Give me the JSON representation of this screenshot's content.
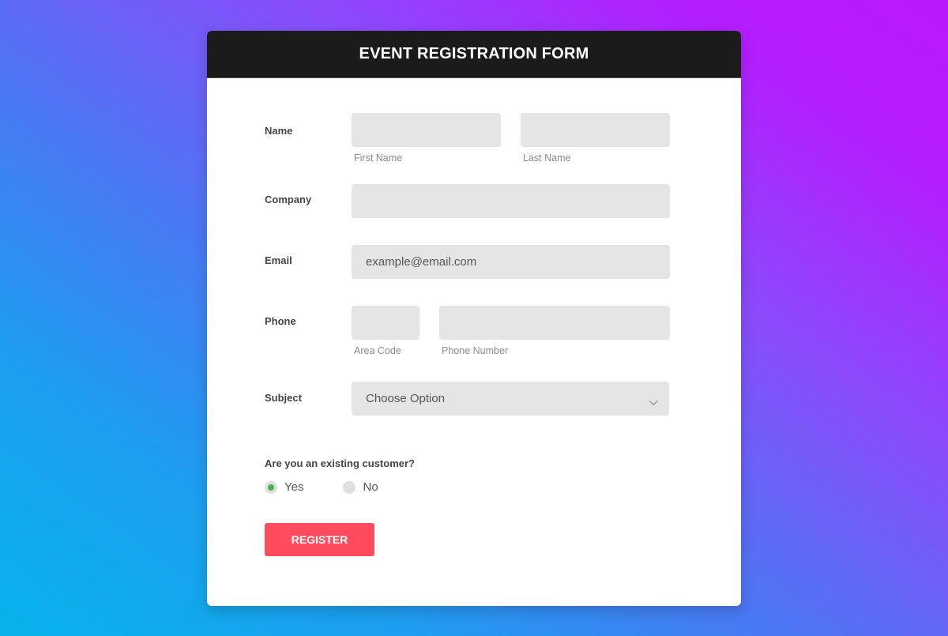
{
  "header": {
    "title": "EVENT REGISTRATION FORM"
  },
  "form": {
    "name": {
      "label": "Name",
      "first_name": {
        "value": "",
        "sublabel": "First Name"
      },
      "last_name": {
        "value": "",
        "sublabel": "Last Name"
      }
    },
    "company": {
      "label": "Company",
      "value": ""
    },
    "email": {
      "label": "Email",
      "placeholder": "example@email.com",
      "value": ""
    },
    "phone": {
      "label": "Phone",
      "area_code": {
        "value": "",
        "sublabel": "Area Code"
      },
      "phone_number": {
        "value": "",
        "sublabel": "Phone Number"
      }
    },
    "subject": {
      "label": "Subject",
      "selected": "Choose Option",
      "icon": "chevron-down-icon"
    },
    "existing_customer": {
      "question": "Are you an existing customer?",
      "options": [
        {
          "label": "Yes",
          "checked": true
        },
        {
          "label": "No",
          "checked": false
        }
      ]
    },
    "submit_label": "REGISTER"
  },
  "colors": {
    "header_bg": "#1b1b1b",
    "input_bg": "#e5e5e5",
    "button_bg": "#ff4b5c",
    "radio_checked": "#45b549",
    "gradient_start": "#07b3ea",
    "gradient_end": "#bb18ff"
  }
}
